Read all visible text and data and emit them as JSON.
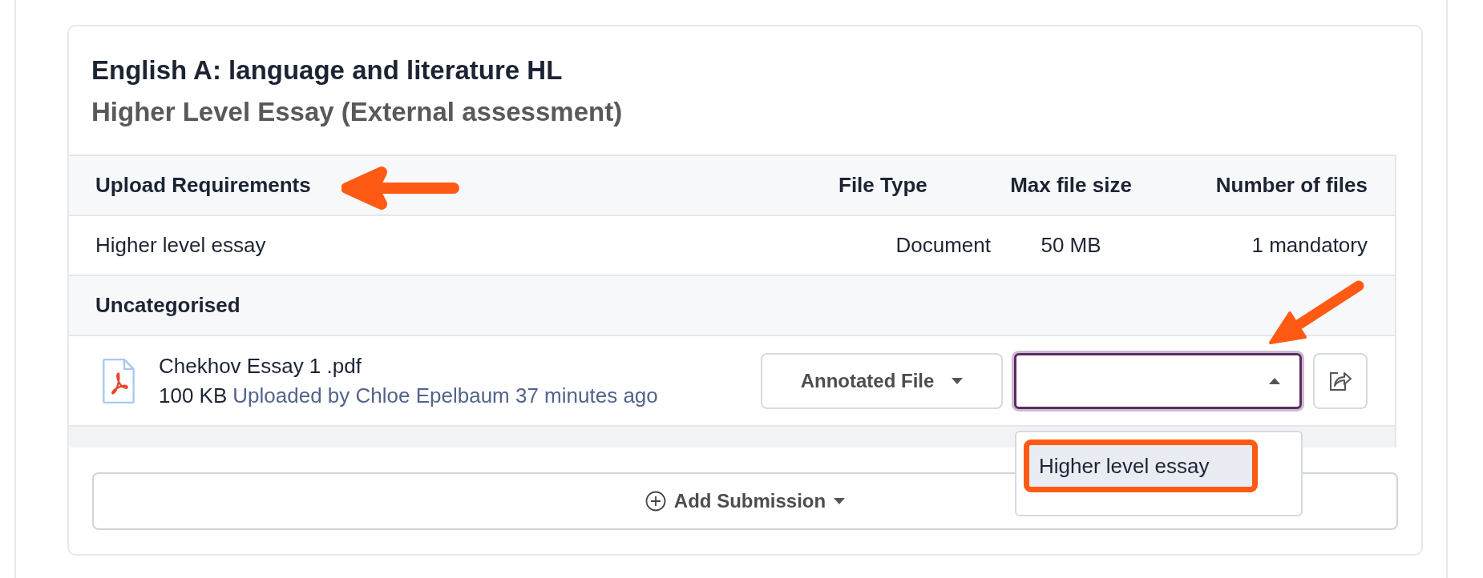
{
  "card": {
    "title": "English A: language and literature HL",
    "subtitle": "Higher Level Essay (External assessment)"
  },
  "requirements": {
    "columns": [
      "Upload Requirements",
      "File Type",
      "Max file size",
      "Number of files"
    ],
    "rows": [
      {
        "name": "Higher level essay",
        "file_type": "Document",
        "max_size": "50 MB",
        "count": "1 mandatory"
      }
    ]
  },
  "group": {
    "label": "Uncategorised"
  },
  "files": [
    {
      "name": "Chekhov Essay 1 .pdf",
      "size": "100 KB",
      "uploaded": "Uploaded by Chloe Epelbaum 37 minutes ago",
      "type_button": "Annotated File",
      "requirement_select": {
        "expanded": true,
        "options": [
          {
            "label": "Higher level essay",
            "selected": false,
            "highlighted": true
          }
        ]
      }
    }
  ],
  "add_button": "Add Submission"
}
